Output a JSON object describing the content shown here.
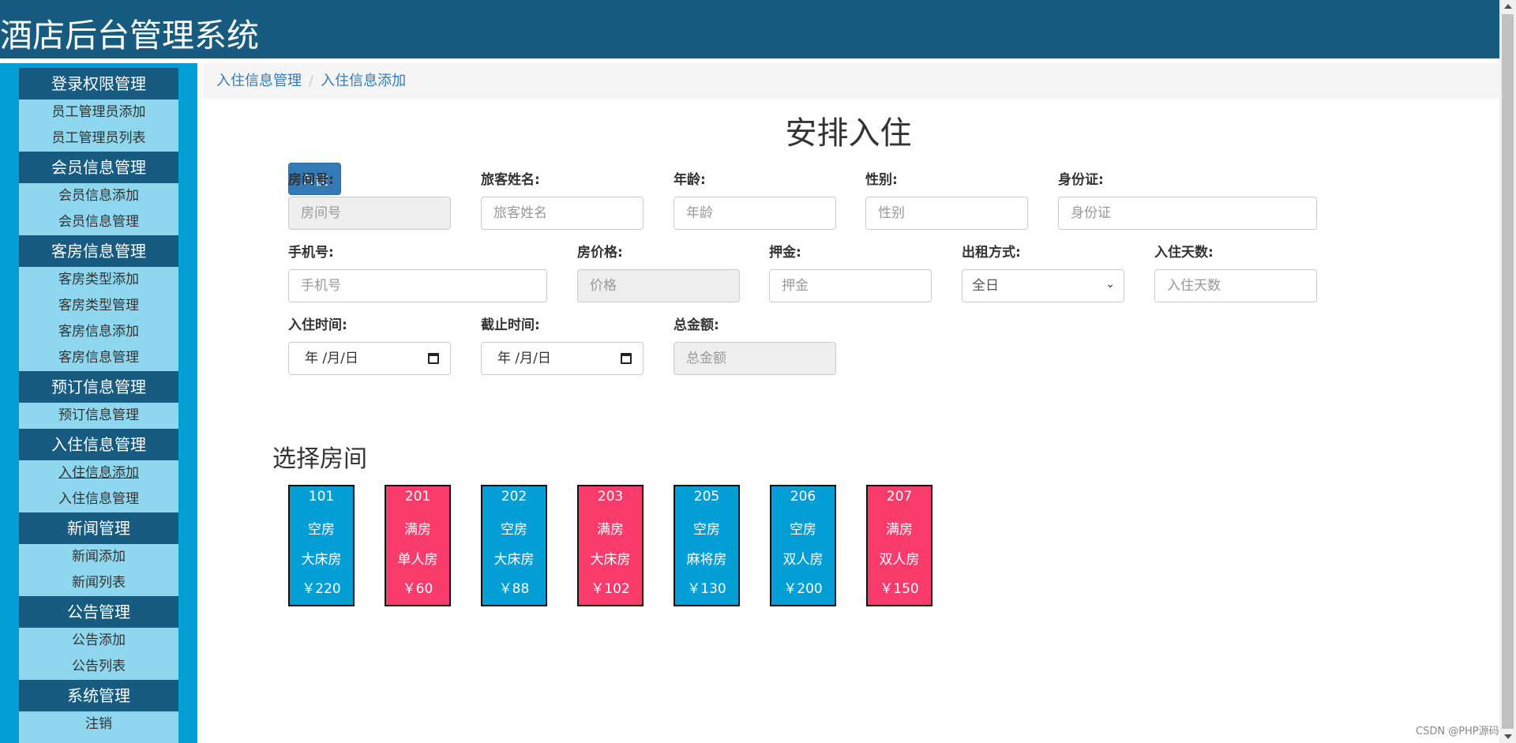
{
  "header": {
    "title": "酒店后台管理系统"
  },
  "sidebar": {
    "groups": [
      {
        "title": "登录权限管理",
        "items": [
          "员工管理员添加",
          "员工管理员列表"
        ]
      },
      {
        "title": "会员信息管理",
        "items": [
          "会员信息添加",
          "会员信息管理"
        ]
      },
      {
        "title": "客房信息管理",
        "items": [
          "客房类型添加",
          "客房类型管理",
          "客房信息添加",
          "客房信息管理"
        ]
      },
      {
        "title": "预订信息管理",
        "items": [
          "预订信息管理"
        ]
      },
      {
        "title": "入住信息管理",
        "items": [
          "入住信息添加",
          "入住信息管理"
        ]
      },
      {
        "title": "新闻管理",
        "items": [
          "新闻添加",
          "新闻列表"
        ]
      },
      {
        "title": "公告管理",
        "items": [
          "公告添加",
          "公告列表"
        ]
      },
      {
        "title": "系统管理",
        "items": [
          "注销"
        ]
      }
    ]
  },
  "breadcrumb": {
    "items": [
      "入住信息管理",
      "入住信息添加"
    ],
    "separator": "/"
  },
  "page": {
    "title": "安排入住",
    "checkin_button": "入住"
  },
  "form": {
    "room_no": {
      "label": "房间号:",
      "placeholder": "房间号"
    },
    "guest_name": {
      "label": "旅客姓名:",
      "placeholder": "旅客姓名"
    },
    "age": {
      "label": "年龄:",
      "placeholder": "年龄"
    },
    "gender": {
      "label": "性别:",
      "placeholder": "性别"
    },
    "id_card": {
      "label": "身份证:",
      "placeholder": "身份证"
    },
    "phone": {
      "label": "手机号:",
      "placeholder": "手机号"
    },
    "price": {
      "label": "房价格:",
      "placeholder": "价格"
    },
    "deposit": {
      "label": "押金:",
      "placeholder": "押金"
    },
    "rent_mode": {
      "label": "出租方式:",
      "value": "全日"
    },
    "days": {
      "label": "入住天数:",
      "placeholder": "入住天数"
    },
    "checkin_time": {
      "label": "入住时间:",
      "value": "年 /月/日"
    },
    "end_time": {
      "label": "截止时间:",
      "value": "年 /月/日"
    },
    "total": {
      "label": "总金额:",
      "placeholder": "总金额"
    }
  },
  "rooms_section": {
    "title": "选择房间"
  },
  "rooms": [
    {
      "number": "101",
      "status": "空房",
      "type": "大床房",
      "price": "￥220"
    },
    {
      "number": "201",
      "status": "满房",
      "type": "单人房",
      "price": "￥60"
    },
    {
      "number": "202",
      "status": "空房",
      "type": "大床房",
      "price": "￥88"
    },
    {
      "number": "203",
      "status": "满房",
      "type": "大床房",
      "price": "￥102"
    },
    {
      "number": "205",
      "status": "空房",
      "type": "麻将房",
      "price": "￥130"
    },
    {
      "number": "206",
      "status": "空房",
      "type": "双人房",
      "price": "￥200"
    },
    {
      "number": "207",
      "status": "满房",
      "type": "双人房",
      "price": "￥150"
    }
  ],
  "colors": {
    "header": "#175b80",
    "sidebar": "#039ed6",
    "menu_item": "#8ed7ee",
    "vacant": "#039ed6",
    "occupied": "#fa3c6d",
    "primary": "#337ab7"
  },
  "watermark": "CSDN @PHP源码"
}
